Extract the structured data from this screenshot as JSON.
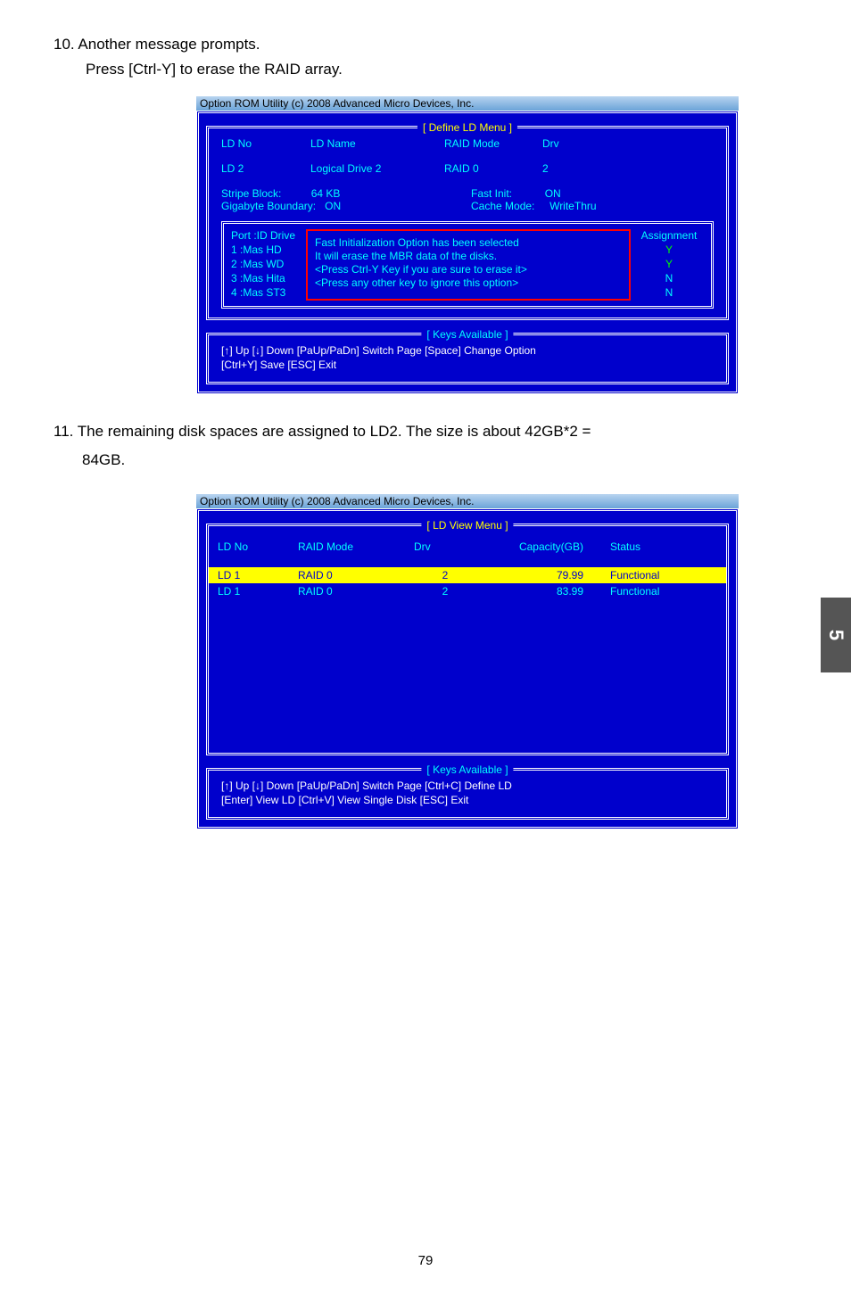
{
  "step10": {
    "line1": "10. Another message prompts.",
    "line2": "Press [Ctrl-Y] to erase the RAID array."
  },
  "bios1": {
    "header": "Option ROM Utility (c) 2008 Advanced Micro Devices, Inc.",
    "section_title": "[ Define LD Menu ]",
    "cols": {
      "ldno": "LD No",
      "ldname": "LD Name",
      "raidmode": "RAID Mode",
      "drv": "Drv"
    },
    "row": {
      "ldno": "LD  2",
      "ldname": "Logical Drive 2",
      "raidmode": "RAID 0",
      "drv": "2"
    },
    "stripe": {
      "label": "Stripe Block:",
      "valsize": "64   KB",
      "gb_label": "Gigabyte Boundary:",
      "gb_val": "ON",
      "fi_label": "Fast Init:",
      "fi_val": "ON",
      "cm_label": "Cache Mode:",
      "cm_val": "WriteThru"
    },
    "drives": {
      "head": "Port :ID  Drive",
      "d1": "1 :Mas HD",
      "d2": "2 :Mas WD",
      "d3": "3 :Mas Hita",
      "d4": "4 :Mas ST3"
    },
    "popup": {
      "l1": "Fast Initialization Option has been selected",
      "l2": "It will erase the MBR data of the disks.",
      "l3": "<Press Ctrl-Y Key if you are sure to erase it>",
      "l4": "<Press any other key to ignore this option>"
    },
    "assign": {
      "head": "Assignment",
      "a1": "Y",
      "a2": "Y",
      "a3": "N",
      "a4": "N"
    },
    "keys_title": "[ Keys Available ]",
    "keys": {
      "l1": "[↑] Up     [↓] Down     [PaUp/PaDn] Switch Page     [Space] Change Option",
      "l2": "[Ctrl+Y] Save     [ESC] Exit"
    }
  },
  "step11": {
    "line1": "11. The remaining disk spaces are assigned to LD2. The size is about 42GB*2 =",
    "line2": "84GB."
  },
  "bios2": {
    "header": "Option ROM Utility (c) 2008 Advanced Micro Devices, Inc.",
    "section_title": "[ LD View Menu ]",
    "head": {
      "ldno": "LD No",
      "mode": "RAID Mode",
      "drv": "Drv",
      "cap": "Capacity(GB)",
      "status": "Status"
    },
    "rows": [
      {
        "ldno": "LD  1",
        "mode": "RAID 0",
        "drv": "2",
        "cap": "79.99",
        "status": "Functional"
      },
      {
        "ldno": "LD  1",
        "mode": "RAID 0",
        "drv": "2",
        "cap": "83.99",
        "status": "Functional"
      }
    ],
    "keys_title": "[ Keys Available ]",
    "keys": {
      "l1": "[↑] Up     [↓] Down     [PaUp/PaDn] Switch Page     [Ctrl+C] Define LD",
      "l2": "[Enter] View LD     [Ctrl+V] View Single Disk     [ESC] Exit"
    }
  },
  "page_tab": "5",
  "page_num": "79"
}
